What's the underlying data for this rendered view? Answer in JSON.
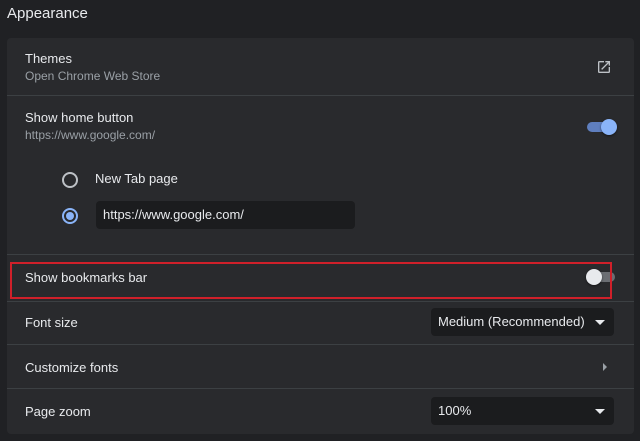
{
  "section": {
    "title": "Appearance"
  },
  "themes": {
    "label": "Themes",
    "sublabel": "Open Chrome Web Store",
    "icon": "external-link-icon"
  },
  "home_button": {
    "label": "Show home button",
    "sublabel": "https://www.google.com/",
    "enabled": true,
    "options": {
      "new_tab_label": "New Tab page",
      "custom_url_value": "https://www.google.com/",
      "selected": "custom_url"
    }
  },
  "bookmarks_bar": {
    "label": "Show bookmarks bar",
    "enabled": false
  },
  "font_size": {
    "label": "Font size",
    "value": "Medium (Recommended)"
  },
  "customize_fonts": {
    "label": "Customize fonts"
  },
  "page_zoom": {
    "label": "Page zoom",
    "value": "100%"
  },
  "colors": {
    "accent": "#8ab4f8",
    "highlight_border": "#d0202a",
    "background": "#202124",
    "card": "#292a2d"
  }
}
